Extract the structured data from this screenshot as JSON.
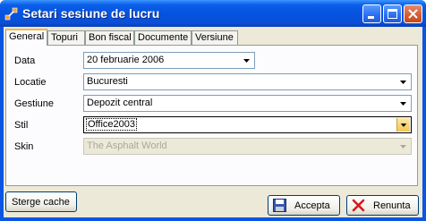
{
  "window": {
    "title": "Setari sesiune de lucru",
    "accent": "#0a55e3"
  },
  "tabs": [
    {
      "label": "General",
      "active": true
    },
    {
      "label": "Topuri"
    },
    {
      "label": "Bon fiscal"
    },
    {
      "label": "Documente"
    },
    {
      "label": "Versiune"
    }
  ],
  "form": {
    "data": {
      "label": "Data",
      "value": "20 februarie 2006"
    },
    "locatie": {
      "label": "Locatie",
      "value": "Bucuresti"
    },
    "gestiune": {
      "label": "Gestiune",
      "value": "Depozit central"
    },
    "stil": {
      "label": "Stil",
      "value": "Office2003"
    },
    "skin": {
      "label": "Skin",
      "value": "The Asphalt World"
    }
  },
  "buttons": {
    "clear_cache": "Sterge cache",
    "accept": "Accepta",
    "cancel": "Renunta"
  },
  "icons": [
    "app-icon",
    "minimize-icon",
    "maximize-icon",
    "close-icon",
    "chevron-down-icon",
    "floppy-icon",
    "x-icon"
  ]
}
